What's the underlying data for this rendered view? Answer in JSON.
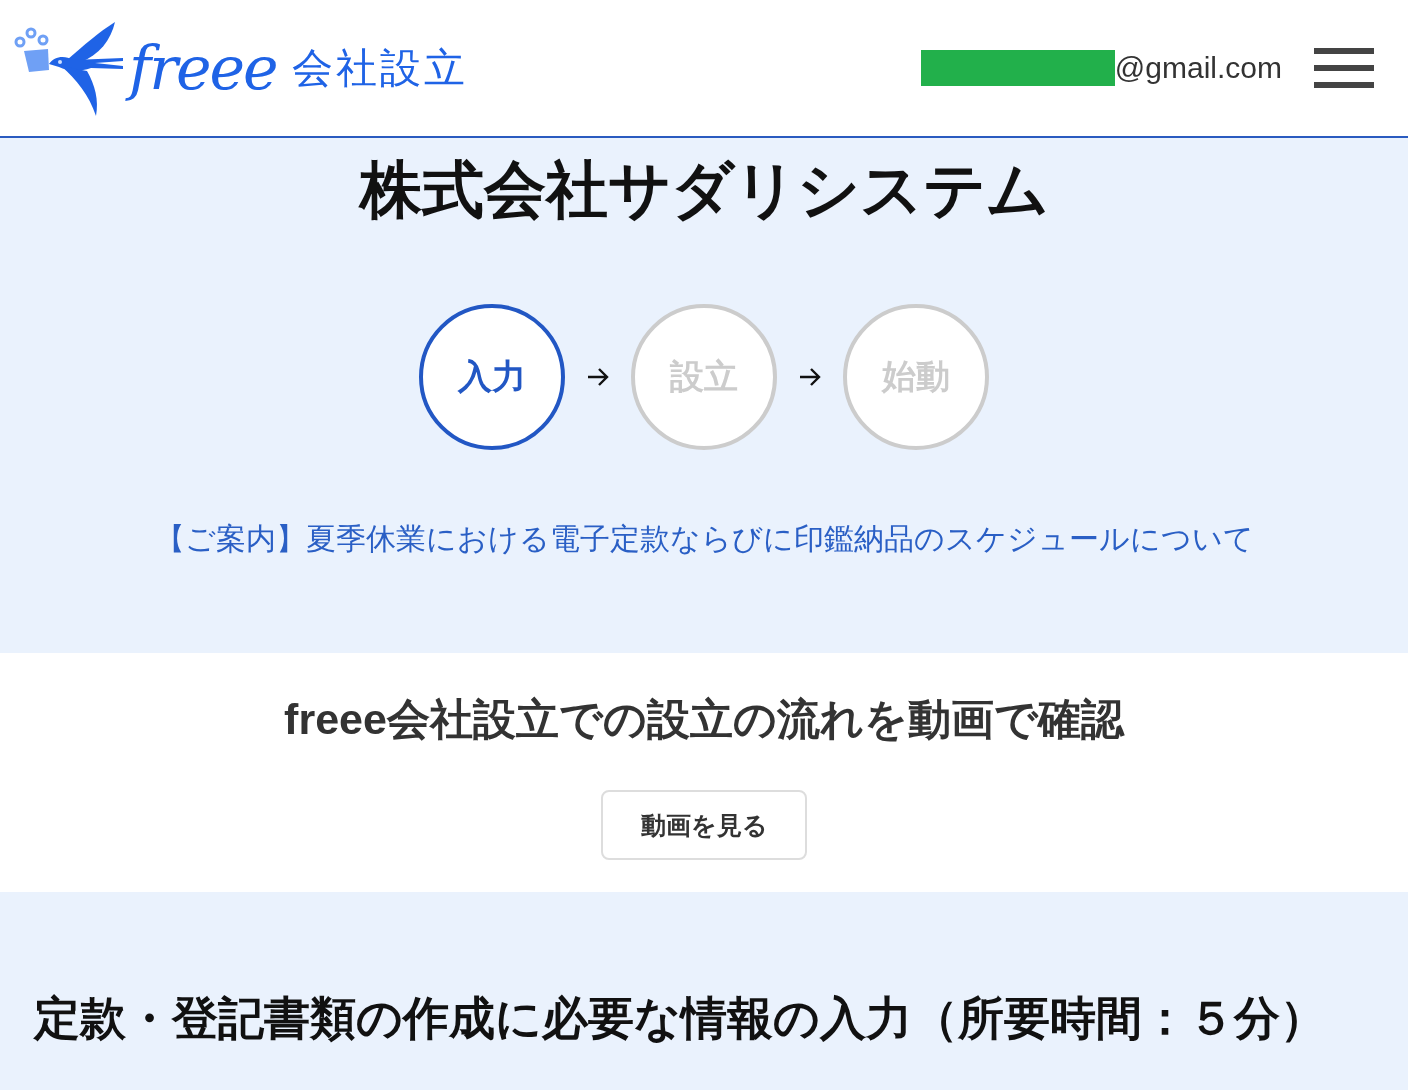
{
  "header": {
    "logo": {
      "wordmark": "freee",
      "product": "会社設立"
    },
    "account": {
      "redacted": true,
      "email": "@gmail.com"
    }
  },
  "company": {
    "name": "株式会社サダリシステム"
  },
  "steps": [
    {
      "label": "入力",
      "active": true
    },
    {
      "label": "設立",
      "active": false
    },
    {
      "label": "始動",
      "active": false
    }
  ],
  "notice": {
    "link": "【ご案内】夏季休業における電子定款ならびに印鑑納品のスケジュールについて"
  },
  "video": {
    "heading": "freee会社設立での設立の流れを動画で確認",
    "button": "動画を見る"
  },
  "input_section": {
    "heading": "定款・登記書類の作成に必要な情報の入力（所要時間：５分）"
  }
}
